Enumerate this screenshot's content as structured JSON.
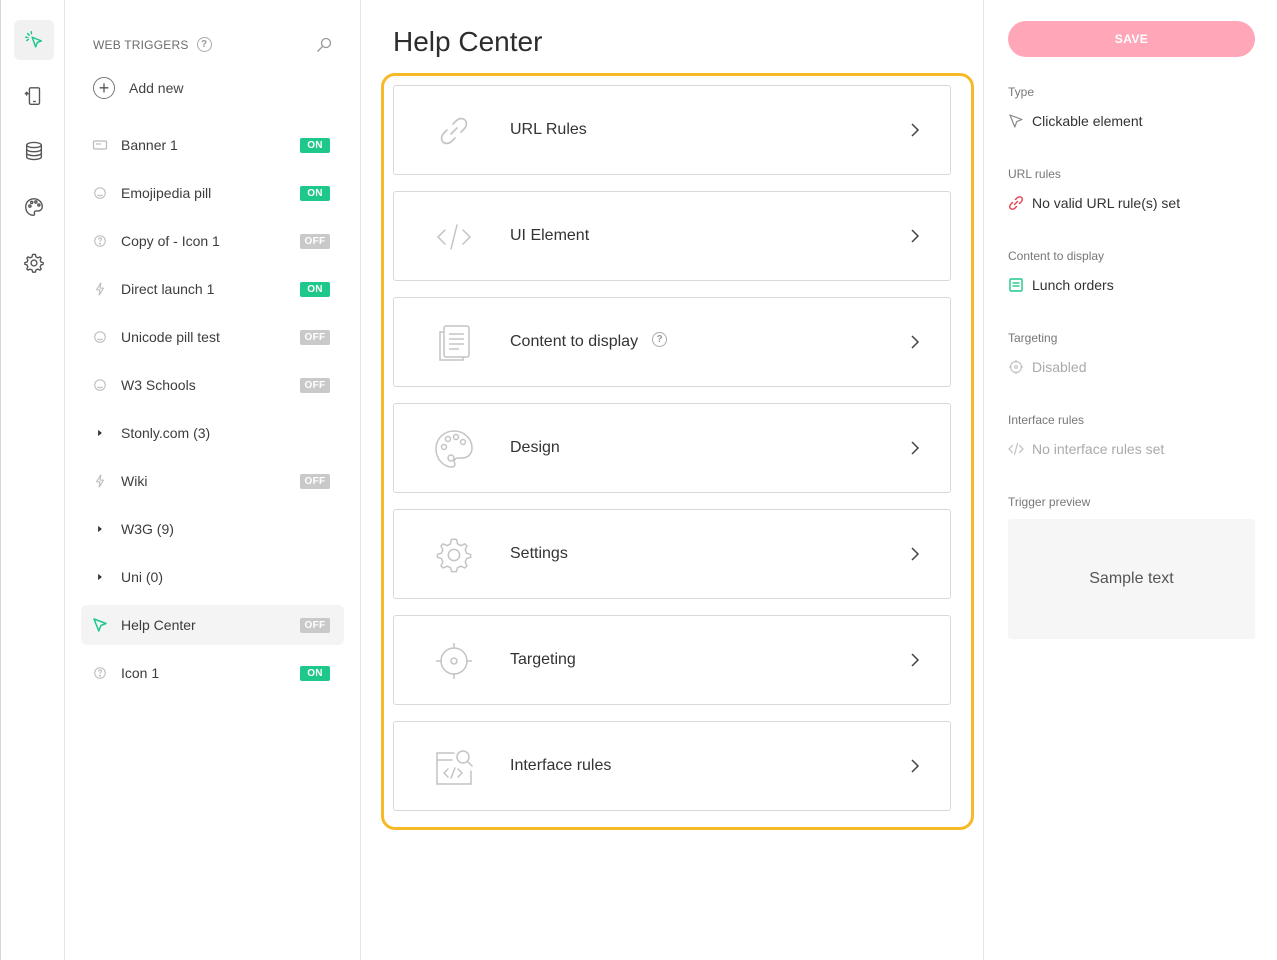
{
  "rail": {
    "items": [
      {
        "name": "web-triggers",
        "icon": "cursor-click-icon"
      },
      {
        "name": "mobile",
        "icon": "mobile-icon"
      },
      {
        "name": "data",
        "icon": "database-icon"
      },
      {
        "name": "themes",
        "icon": "palette-icon"
      },
      {
        "name": "settings",
        "icon": "gear-icon"
      }
    ]
  },
  "sidebar": {
    "title": "WEB TRIGGERS",
    "add_label": "Add new",
    "items": [
      {
        "label": "Banner 1",
        "status": "ON",
        "icon": "banner-icon"
      },
      {
        "label": "Emojipedia pill",
        "status": "ON",
        "icon": "pill-icon"
      },
      {
        "label": "Copy of - Icon 1",
        "status": "OFF",
        "icon": "help-icon"
      },
      {
        "label": "Direct launch 1",
        "status": "ON",
        "icon": "lightning-icon"
      },
      {
        "label": "Unicode pill test",
        "status": "OFF",
        "icon": "pill-icon"
      },
      {
        "label": "W3 Schools",
        "status": "OFF",
        "icon": "pill-icon"
      },
      {
        "label": "Stonly.com (3)",
        "status": "",
        "icon": "caret-right-icon"
      },
      {
        "label": "Wiki",
        "status": "OFF",
        "icon": "lightning-icon"
      },
      {
        "label": "W3G (9)",
        "status": "",
        "icon": "caret-right-icon"
      },
      {
        "label": "Uni (0)",
        "status": "",
        "icon": "caret-right-icon"
      },
      {
        "label": "Help Center",
        "status": "OFF",
        "icon": "cursor-icon"
      },
      {
        "label": "Icon 1",
        "status": "ON",
        "icon": "help-icon"
      }
    ]
  },
  "main": {
    "title": "Help Center",
    "cards": [
      {
        "label": "URL Rules",
        "icon": "link-icon"
      },
      {
        "label": "UI Element",
        "icon": "code-icon"
      },
      {
        "label": "Content to display",
        "icon": "document-icon"
      },
      {
        "label": "Design",
        "icon": "palette-icon"
      },
      {
        "label": "Settings",
        "icon": "gear-icon"
      },
      {
        "label": "Targeting",
        "icon": "target-icon"
      },
      {
        "label": "Interface rules",
        "icon": "interface-search-icon"
      }
    ]
  },
  "right": {
    "save_label": "SAVE",
    "type_label": "Type",
    "type_value": "Clickable element",
    "url_label": "URL rules",
    "url_value": "No valid URL rule(s) set",
    "content_label": "Content to display",
    "content_value": "Lunch orders",
    "targeting_label": "Targeting",
    "targeting_value": "Disabled",
    "interface_label": "Interface rules",
    "interface_value": "No interface rules set",
    "preview_label": "Trigger preview",
    "preview_text": "Sample text"
  },
  "colors": {
    "accent_green": "#1ec88a",
    "save_pink": "#ffa6b9",
    "highlight_yellow": "#f7b928",
    "error_red": "#e5404f"
  }
}
